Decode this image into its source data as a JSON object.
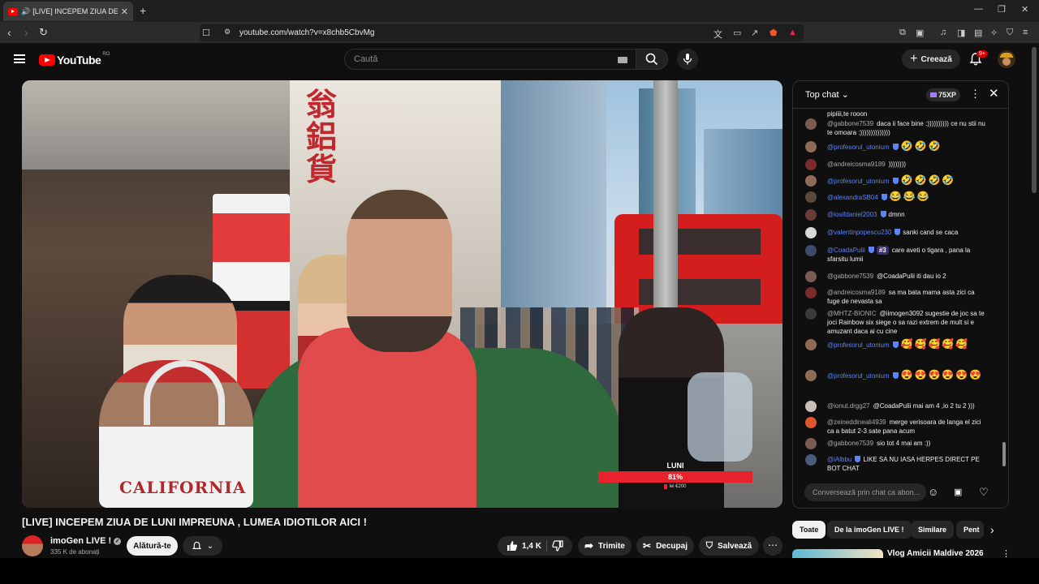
{
  "browser": {
    "tab_title": "[LIVE] INCEPEM ZIUA DE LUNI",
    "url": "youtube.com/watch?v=x8chb5CbvMg"
  },
  "header": {
    "logo_text": "YouTube",
    "region": "RO",
    "search_placeholder": "Caută",
    "create_label": "Creează",
    "notifications_badge": "9+"
  },
  "video": {
    "overlay_label": "LUNI",
    "overlay_percent": "81%",
    "overlay_progress": 0.81,
    "overlay_sub": "lei €200",
    "shirt_text": "CALIFORNIA",
    "title": "[LIVE] INCEPEM ZIUA DE LUNI IMPREUNA , LUMEA IDIOTILOR AICI !"
  },
  "channel": {
    "name": "imoGen LIVE !",
    "subscribers": "335 K de abonați",
    "join_label": "Alătură-te"
  },
  "actions": {
    "likes": "1,4 K",
    "share": "Trimite",
    "clip": "Decupaj",
    "save": "Salvează"
  },
  "chat": {
    "header": "Top chat",
    "xp": "75XP",
    "input_placeholder": "Conversează prin chat ca abon...",
    "messages": [
      {
        "author": "",
        "text": "pipiiii,te rooon",
        "mod": false
      },
      {
        "author": "@gabbone7539",
        "text": "daca ii face bine :)))))))))) ce nu stii nu te omoara :))))))))))))))",
        "mod": false
      },
      {
        "author": "@profesorul_utonium",
        "text": "🤣🤣🤣",
        "mod": true
      },
      {
        "author": "@andreicosma9189",
        "text": "))))))))",
        "mod": false
      },
      {
        "author": "@profesorul_utonium",
        "text": "🤣🤣🤣🤣",
        "mod": true
      },
      {
        "author": "@alexandraSB04",
        "text": "😂😂😂",
        "mod": true
      },
      {
        "author": "@iosifdaniel2003",
        "text": "dmnn",
        "mod": true
      },
      {
        "author": "@valentinpopescu230",
        "text": "sanki cand se caca",
        "mod": true
      },
      {
        "author": "@CoadaPulii",
        "rank": "#3",
        "text": "care aveti o tigara , pana la sfarsitu lumii",
        "mod": true
      },
      {
        "author": "@gabbone7539",
        "text": "@CoadaPulii iti dau io 2",
        "mod": false
      },
      {
        "author": "@andreicosma9189",
        "text": "sa ma bata mama asta zici ca fuge de nevasta sa",
        "mod": false
      },
      {
        "author": "@MHTZ-BIONIC",
        "text": "@iimogen3092 sugestie de joc sa te joci Rainbow six siege o sa razi extrem de mult si e amuzant daca ai cu cine",
        "mod": false
      },
      {
        "author": "@profesorul_utonium",
        "text": "🥰🥰🥰🥰🥰",
        "mod": true
      },
      {
        "author": "@profesorul_utonium",
        "text": "😍😍😍😍😍😍",
        "mod": true
      },
      {
        "author": "@ionut.drgg27",
        "text": "@CoadaPulii mai am 4 ,io 2 tu 2 )))",
        "mod": false
      },
      {
        "author": "@zeineddineali4939",
        "text": "merge verisoara de langa el zici ca a batut 2-3 sate pana acum",
        "mod": false
      },
      {
        "author": "@gabbone7539",
        "text": "sio tot 4 mai am :))",
        "mod": false
      },
      {
        "author": "@iAlbbu",
        "text": "LIKE SA NU IASA HERPES DIRECT PE BOT CHAT",
        "mod": true
      }
    ]
  },
  "chips": [
    "Toate",
    "De la imoGen LIVE !",
    "Similare",
    "Pent"
  ],
  "recommendation": {
    "title": "Vlog Amicii Maldive 2026"
  },
  "colors": {
    "background": "#0f0f0f",
    "accent_red": "#ff0000",
    "mod_blue": "#5e84f1"
  }
}
